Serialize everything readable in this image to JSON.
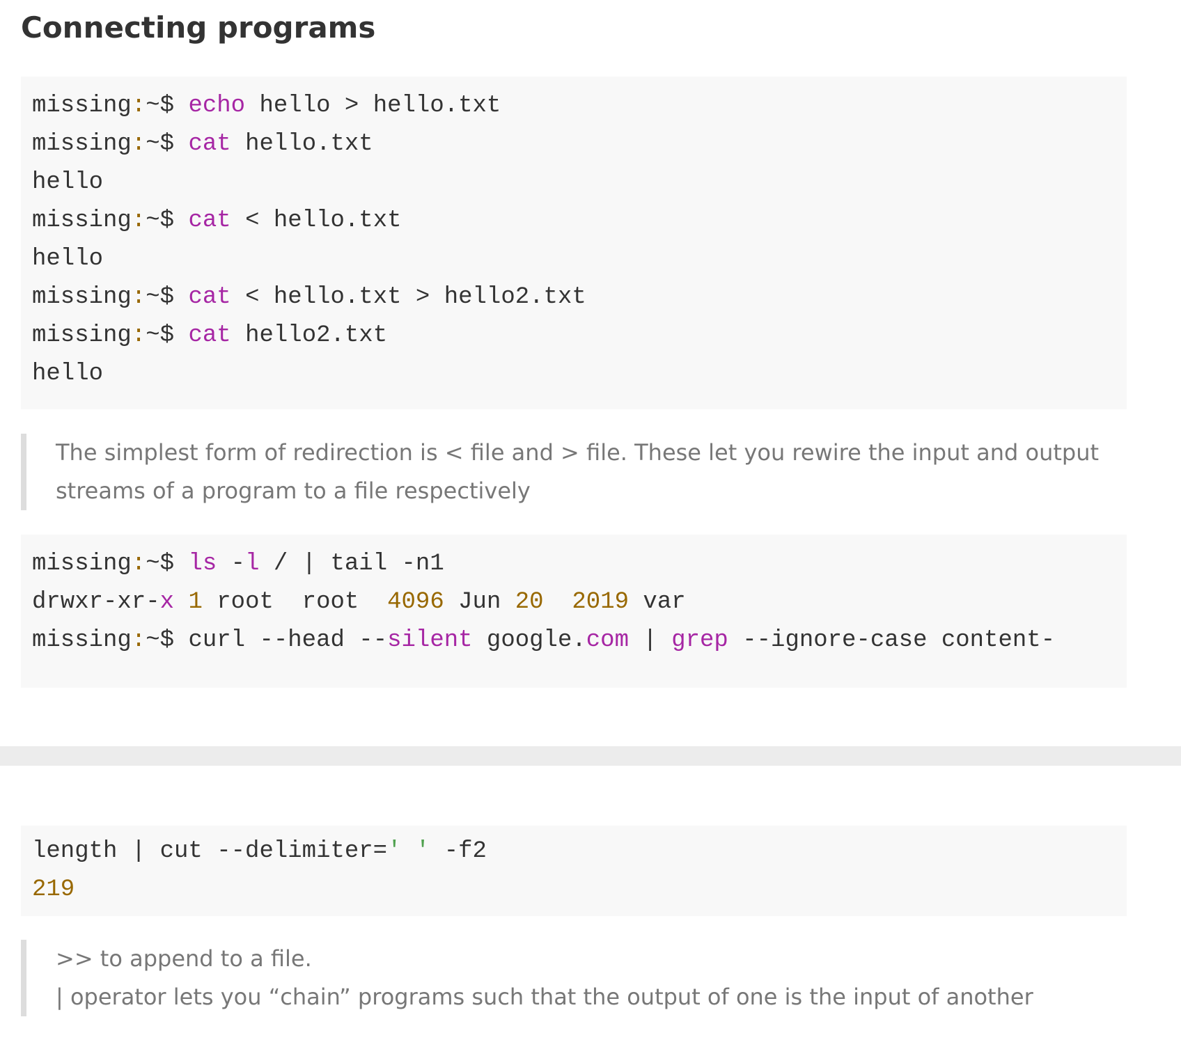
{
  "heading": "Connecting programs",
  "code_block_1": {
    "lines": [
      {
        "prompt": "missing",
        "sep": ":",
        "path": "~$ ",
        "cmd": "echo",
        "rest": " hello > hello.txt"
      },
      {
        "prompt": "missing",
        "sep": ":",
        "path": "~$ ",
        "cmd": "cat",
        "rest": " hello.txt"
      },
      {
        "output": "hello"
      },
      {
        "prompt": "missing",
        "sep": ":",
        "path": "~$ ",
        "cmd": "cat",
        "rest": " < hello.txt"
      },
      {
        "output": "hello"
      },
      {
        "prompt": "missing",
        "sep": ":",
        "path": "~$ ",
        "cmd": "cat",
        "rest": " < hello.txt > hello2.txt"
      },
      {
        "prompt": "missing",
        "sep": ":",
        "path": "~$ ",
        "cmd": "cat",
        "rest": " hello2.txt"
      },
      {
        "output": "hello"
      }
    ]
  },
  "quote_1": {
    "line1": "The simplest form of redirection is < file and > file. These let you rewire the input and output",
    "line2": "streams of a program to a file respectively"
  },
  "code_block_2": {
    "line1": {
      "prompt": "missing",
      "sep": ":",
      "path": "~$ ",
      "cmd": "ls",
      "flag_dash": " -",
      "flag": "l",
      "rest": " / | tail -n1"
    },
    "line2": {
      "perms": "drwxr-xr-",
      "perm_x": "x",
      "sp1": " ",
      "links": "1",
      "owner": " root  root  ",
      "size": "4096",
      "month": " Jun ",
      "day": "20",
      "sp2": "  ",
      "year": "2019",
      "name": " var"
    },
    "line3": {
      "prompt": "missing",
      "sep": ":",
      "path": "~$ ",
      "cmd": "curl --head --",
      "silent": "silent",
      "host": " google.",
      "tld": "com",
      "pipe": " | ",
      "grep": "grep",
      "rest": " --ignore-case content-"
    }
  },
  "code_block_3": {
    "line1": {
      "text": "length | cut --delimiter=",
      "str": "' '",
      "rest": " -f2"
    },
    "line2": {
      "number": "219"
    }
  },
  "quote_2": {
    "line1": ">> to append to a file.",
    "line2": "| operator lets you “chain” programs such that the output of one is the input of another"
  },
  "colors": {
    "text": "#333333",
    "keyword": "#a626a4",
    "number": "#986801",
    "string": "#50a14f",
    "code_background": "#f8f8f8",
    "quote_text": "#777777",
    "quote_border": "#dddddd",
    "divider": "#ececec"
  }
}
